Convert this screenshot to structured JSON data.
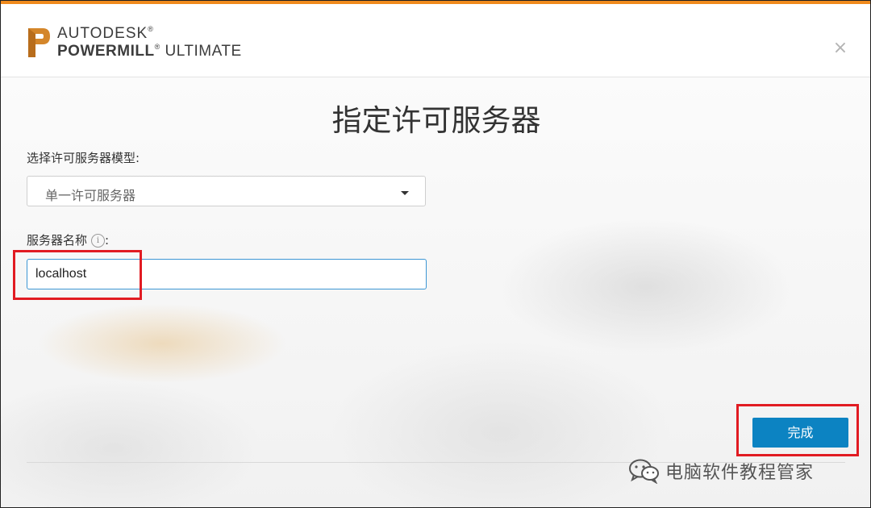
{
  "window": {
    "brand_line1": "AUTODESK",
    "brand_line2_bold": "POWERMILL",
    "brand_line2_rest": "ULTIMATE",
    "close_glyph": "×",
    "logo_icon": "autodesk-p-logo",
    "accent_color": "#f08a1c"
  },
  "dialog": {
    "title": "指定许可服务器",
    "model_label": "选择许可服务器模型:",
    "model_selected": "单一许可服务器",
    "server_label": "服务器名称",
    "server_label_suffix": ":",
    "info_glyph": "i",
    "server_value": "localhost",
    "done_label": "完成",
    "button_color": "#0c83c2"
  },
  "annotations": {
    "highlight_color": "#e11b22"
  },
  "watermark": {
    "text": "电脑软件教程管家",
    "icon": "wechat-icon"
  }
}
